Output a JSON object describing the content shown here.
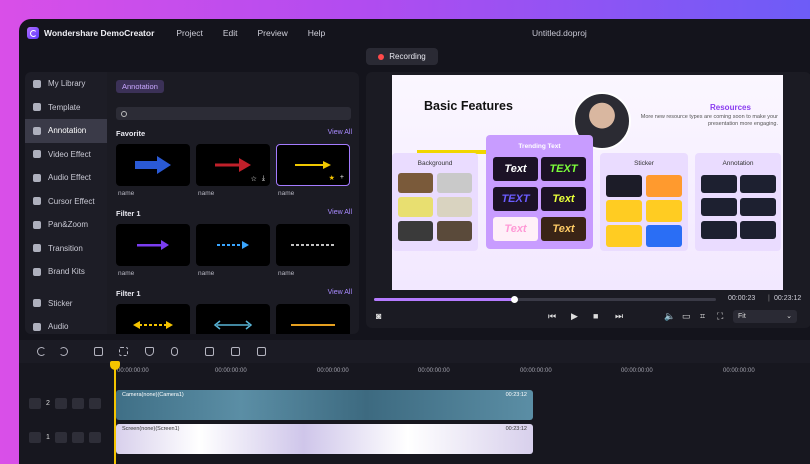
{
  "titlebar": {
    "app_name": "Wondershare DemoCreator",
    "menu": [
      "Project",
      "Edit",
      "Preview",
      "Help"
    ],
    "document_title": "Untitled.doproj"
  },
  "record_button": {
    "label": "Recording"
  },
  "sidebar": {
    "items": [
      {
        "label": "My Library",
        "icon": "library-icon"
      },
      {
        "label": "Template",
        "icon": "template-icon"
      },
      {
        "label": "Annotation",
        "icon": "annotation-icon",
        "active": true
      },
      {
        "label": "Video Effect",
        "icon": "video-effect-icon"
      },
      {
        "label": "Audio Effect",
        "icon": "audio-effect-icon"
      },
      {
        "label": "Cursor Effect",
        "icon": "cursor-effect-icon"
      },
      {
        "label": "Pan&Zoom",
        "icon": "pan-zoom-icon"
      },
      {
        "label": "Transition",
        "icon": "transition-icon"
      },
      {
        "label": "Brand Kits",
        "icon": "brand-kits-icon"
      },
      {
        "label": "Sticker",
        "icon": "sticker-icon"
      },
      {
        "label": "Audio",
        "icon": "audio-icon"
      }
    ]
  },
  "library": {
    "tag": "Annotation",
    "search_placeholder": "",
    "sections": [
      {
        "title": "Favorite",
        "view_all": "View All",
        "cards": [
          {
            "name": "name",
            "arrow_color": "#2a5ad6"
          },
          {
            "name": "name",
            "arrow_color": "#c0202a"
          },
          {
            "name": "name",
            "arrow_color": "#f0c800"
          }
        ]
      },
      {
        "title": "Filter 1",
        "view_all": "View All",
        "cards": [
          {
            "name": "name",
            "arrow_color": "#7a3df0"
          },
          {
            "name": "name",
            "arrow_color": "#3aa6ff"
          },
          {
            "name": "name",
            "arrow_color": "#ffffff"
          }
        ]
      },
      {
        "title": "Filter 1",
        "view_all": "View All",
        "cards": [
          {
            "name": "",
            "arrow_color": "#f4c400"
          },
          {
            "name": "",
            "arrow_color": "#59b4d6"
          },
          {
            "name": "",
            "arrow_color": "#e6a020"
          }
        ]
      }
    ]
  },
  "preview": {
    "slide": {
      "heading": "Basic Features",
      "resources_title": "Resources",
      "resources_text": "More new resource types are coming soon to make your presentation more engaging.",
      "boxes": [
        "Background",
        "Trending Text",
        "Sticker",
        "Annotation"
      ],
      "trending_words": [
        "Text",
        "TEXT",
        "TEXT",
        "Text",
        "Text",
        "Text"
      ]
    },
    "current_time": "00:00:23",
    "total_time": "00:23:12",
    "progress": 0.41,
    "fit_option": "Fit"
  },
  "timeline": {
    "ruler": [
      "00:00:00:00",
      "00:00:00:00",
      "00:00:00:00",
      "00:00:00:00",
      "00:00:00:00",
      "00:00:00:00",
      "00:00:00:00"
    ],
    "tracks": [
      {
        "number": "2",
        "clip_label": "Camera(none)(Camera1)",
        "clip_duration": "00:23:12"
      },
      {
        "number": "1",
        "clip_label": "Screen(none)(Screen1)",
        "clip_duration": "00:23:12"
      }
    ]
  },
  "colors": {
    "accent": "#a47bff",
    "playhead": "#f4c400",
    "record": "#ff4a4a"
  }
}
